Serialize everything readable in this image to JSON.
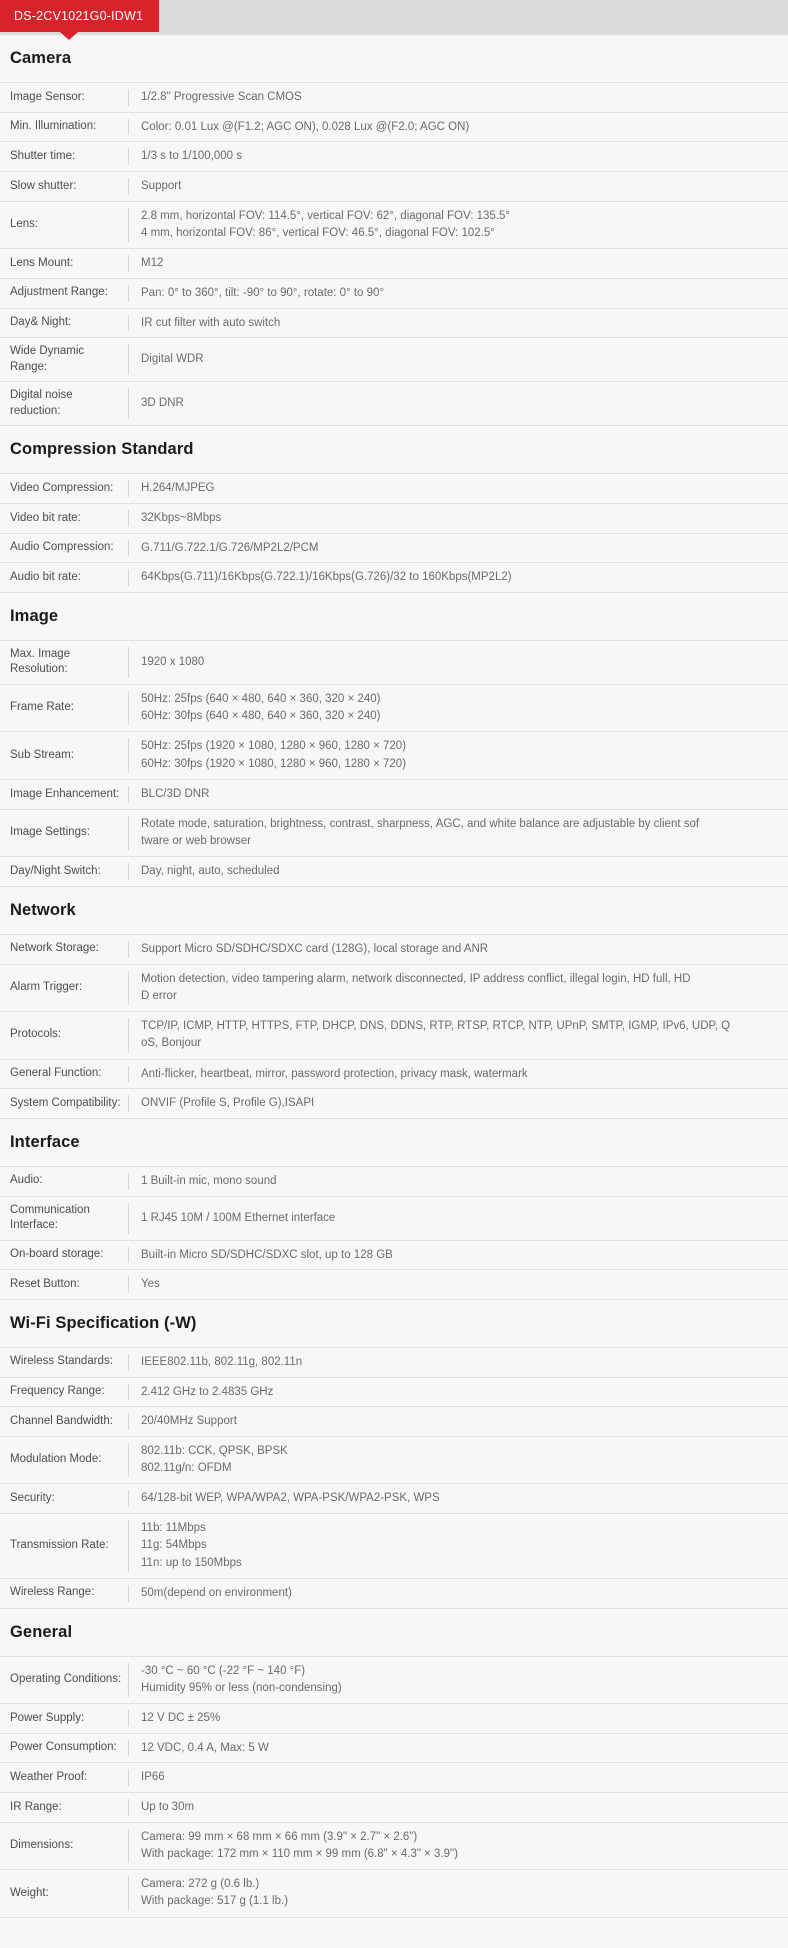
{
  "model": {
    "label": "DS-2CV1021G0-IDW1",
    "tab_color": "#d8232a"
  },
  "sections": [
    {
      "title": "Camera",
      "rows": [
        {
          "label": "Image Sensor:",
          "value": "1/2.8\" Progressive Scan CMOS"
        },
        {
          "label": "Min. Illumination:",
          "value": "Color: 0.01 Lux @(F1.2; AGC ON), 0.028 Lux @(F2.0; AGC ON)"
        },
        {
          "label": "Shutter time:",
          "value": "1/3 s to 1/100,000 s"
        },
        {
          "label": "Slow shutter:",
          "value": "Support"
        },
        {
          "label": "Lens:",
          "value": "2.8 mm, horizontal FOV: 114.5°, vertical FOV: 62°, diagonal FOV: 135.5°\n4 mm, horizontal FOV: 86°, vertical FOV: 46.5°, diagonal FOV: 102.5°"
        },
        {
          "label": "Lens Mount:",
          "value": "M12"
        },
        {
          "label": "Adjustment Range:",
          "value": "Pan: 0° to 360°, tilt: -90° to 90°, rotate: 0° to 90°"
        },
        {
          "label": "Day& Night:",
          "value": "IR cut filter with auto switch"
        },
        {
          "label": "Wide Dynamic Range:",
          "value": "Digital WDR"
        },
        {
          "label": "Digital noise reduction:",
          "value": "3D DNR"
        }
      ]
    },
    {
      "title": "Compression Standard",
      "rows": [
        {
          "label": "Video Compression:",
          "value": "H.264/MJPEG"
        },
        {
          "label": "Video bit rate:",
          "value": "32Kbps~8Mbps"
        },
        {
          "label": "Audio Compression:",
          "value": "G.711/G.722.1/G.726/MP2L2/PCM"
        },
        {
          "label": "Audio bit rate:",
          "value": "64Kbps(G.711)/16Kbps(G.722.1)/16Kbps(G.726)/32 to 160Kbps(MP2L2)"
        }
      ]
    },
    {
      "title": "Image",
      "rows": [
        {
          "label": "Max. Image Resolution:",
          "value": "1920 x 1080"
        },
        {
          "label": "Frame Rate:",
          "value": "50Hz: 25fps (640 × 480, 640 × 360, 320 × 240)\n60Hz: 30fps (640 × 480, 640 × 360, 320 × 240)"
        },
        {
          "label": "Sub Stream:",
          "value": "50Hz: 25fps (1920 × 1080, 1280 × 960, 1280 × 720)\n60Hz: 30fps (1920 × 1080, 1280 × 960, 1280 × 720)"
        },
        {
          "label": "Image Enhancement:",
          "value": "BLC/3D DNR"
        },
        {
          "label": "Image Settings:",
          "value": "Rotate mode, saturation, brightness, contrast, sharpness, AGC, and white balance are adjustable by client sof\ntware or web browser"
        },
        {
          "label": "Day/Night Switch:",
          "value": "Day, night, auto, scheduled"
        }
      ]
    },
    {
      "title": "Network",
      "rows": [
        {
          "label": "Network Storage:",
          "value": "Support Micro SD/SDHC/SDXC card (128G), local storage and ANR"
        },
        {
          "label": "Alarm Trigger:",
          "value": "Motion detection, video tampering alarm, network disconnected, IP address conflict, illegal login, HD full, HD\nD error"
        },
        {
          "label": "Protocols:",
          "value": "TCP/IP, ICMP, HTTP, HTTPS, FTP, DHCP, DNS, DDNS, RTP, RTSP, RTCP, NTP, UPnP, SMTP, IGMP, IPv6, UDP, Q\noS, Bonjour"
        },
        {
          "label": "General Function:",
          "value": "Anti-flicker, heartbeat, mirror, password protection, privacy mask, watermark"
        },
        {
          "label": "System Compatibility:",
          "value": "ONVIF (Profile S, Profile G),ISAPI"
        }
      ]
    },
    {
      "title": "Interface",
      "rows": [
        {
          "label": "Audio:",
          "value": "1 Built-in mic, mono sound"
        },
        {
          "label": "Communication Interface:",
          "value": "1 RJ45 10M / 100M Ethernet interface"
        },
        {
          "label": "On-board storage:",
          "value": "Built-in Micro SD/SDHC/SDXC slot, up to 128 GB"
        },
        {
          "label": "Reset Button:",
          "value": "Yes"
        }
      ]
    },
    {
      "title": "Wi-Fi Specification (-W)",
      "rows": [
        {
          "label": "Wireless Standards:",
          "value": "IEEE802.11b, 802.11g, 802.11n"
        },
        {
          "label": "Frequency Range:",
          "value": "2.412 GHz to 2.4835 GHz"
        },
        {
          "label": "Channel Bandwidth:",
          "value": "20/40MHz Support"
        },
        {
          "label": "Modulation Mode:",
          "value": "802.11b: CCK, QPSK, BPSK\n802.11g/n: OFDM"
        },
        {
          "label": "Security:",
          "value": "64/128-bit WEP, WPA/WPA2, WPA-PSK/WPA2-PSK, WPS"
        },
        {
          "label": "Transmission Rate:",
          "value": "11b: 11Mbps\n11g: 54Mbps\n11n: up to 150Mbps"
        },
        {
          "label": "Wireless Range:",
          "value": "50m(depend on environment)"
        }
      ]
    },
    {
      "title": "General",
      "rows": [
        {
          "label": "Operating Conditions:",
          "value": "-30 °C ~ 60 °C (-22 °F ~ 140 °F)\nHumidity 95% or less (non-condensing)"
        },
        {
          "label": "Power Supply:",
          "value": "12 V DC ± 25%"
        },
        {
          "label": "Power Consumption:",
          "value": "12 VDC, 0.4 A, Max: 5 W"
        },
        {
          "label": "Weather Proof:",
          "value": "IP66"
        },
        {
          "label": "IR Range:",
          "value": "Up to 30m"
        },
        {
          "label": "Dimensions:",
          "value": "Camera: 99 mm × 68 mm × 66 mm (3.9\" × 2.7\" × 2.6\")\nWith package: 172 mm × 110 mm × 99 mm (6.8\" × 4.3\" × 3.9\")"
        },
        {
          "label": "Weight:",
          "value": "Camera: 272 g (0.6 lb.)\nWith package: 517 g (1.1 lb.)"
        }
      ]
    }
  ]
}
